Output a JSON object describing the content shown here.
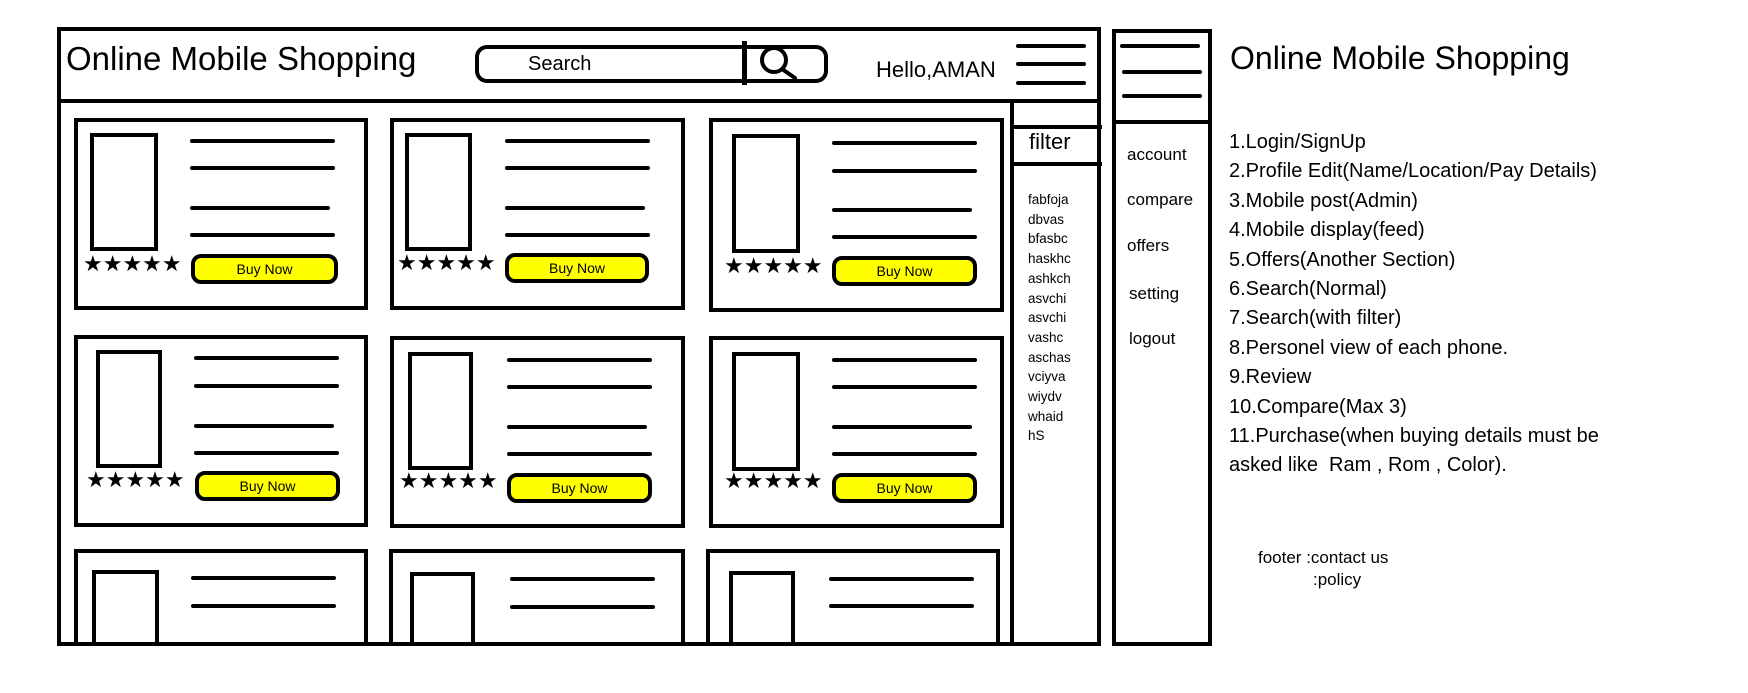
{
  "header": {
    "title": "Online Mobile Shopping",
    "search_placeholder": "Search",
    "greeting": "Hello,AMAN"
  },
  "icons": {
    "search": "search-icon",
    "menu": "hamburger-menu-icon",
    "rating": "star-icon"
  },
  "colors": {
    "buy_button": "#ffff00",
    "stroke": "#000000"
  },
  "products": [
    {
      "rating": "★★★★★",
      "button_label": "Buy Now"
    },
    {
      "rating": "★★★★★",
      "button_label": "Buy Now"
    },
    {
      "rating": "★★★★★",
      "button_label": "Buy Now"
    },
    {
      "rating": "★★★★★",
      "button_label": "Buy Now"
    },
    {
      "rating": "★★★★★",
      "button_label": "Buy Now"
    },
    {
      "rating": "★★★★★",
      "button_label": "Buy Now"
    }
  ],
  "filter": {
    "label": "filter",
    "options": [
      "fabfoja",
      "dbvas",
      "bfasbc",
      "haskhc",
      "ashkch",
      "asvchi",
      "asvchi",
      "vashc",
      "aschas",
      "vciyva",
      "wiydv",
      "whaid",
      "hS"
    ]
  },
  "side_menu": {
    "items": [
      "account",
      "compare",
      "offers",
      "setting",
      "logout"
    ]
  },
  "notes": {
    "title": "Online Mobile Shopping",
    "items": [
      "1.Login/SignUp",
      "2.Profile Edit(Name/Location/Pay Details)",
      "3.Mobile post(Admin)",
      "4.Mobile display(feed)",
      "5.Offers(Another Section)",
      "6.Search(Normal)",
      "7.Search(with filter)",
      "8.Personel view of each phone.",
      "9.Review",
      "10.Compare(Max 3)",
      "11.Purchase(when buying details must be",
      "asked like  Ram , Rom , Color)."
    ],
    "footer_line1": "footer :contact us",
    "footer_line2": ":policy"
  }
}
